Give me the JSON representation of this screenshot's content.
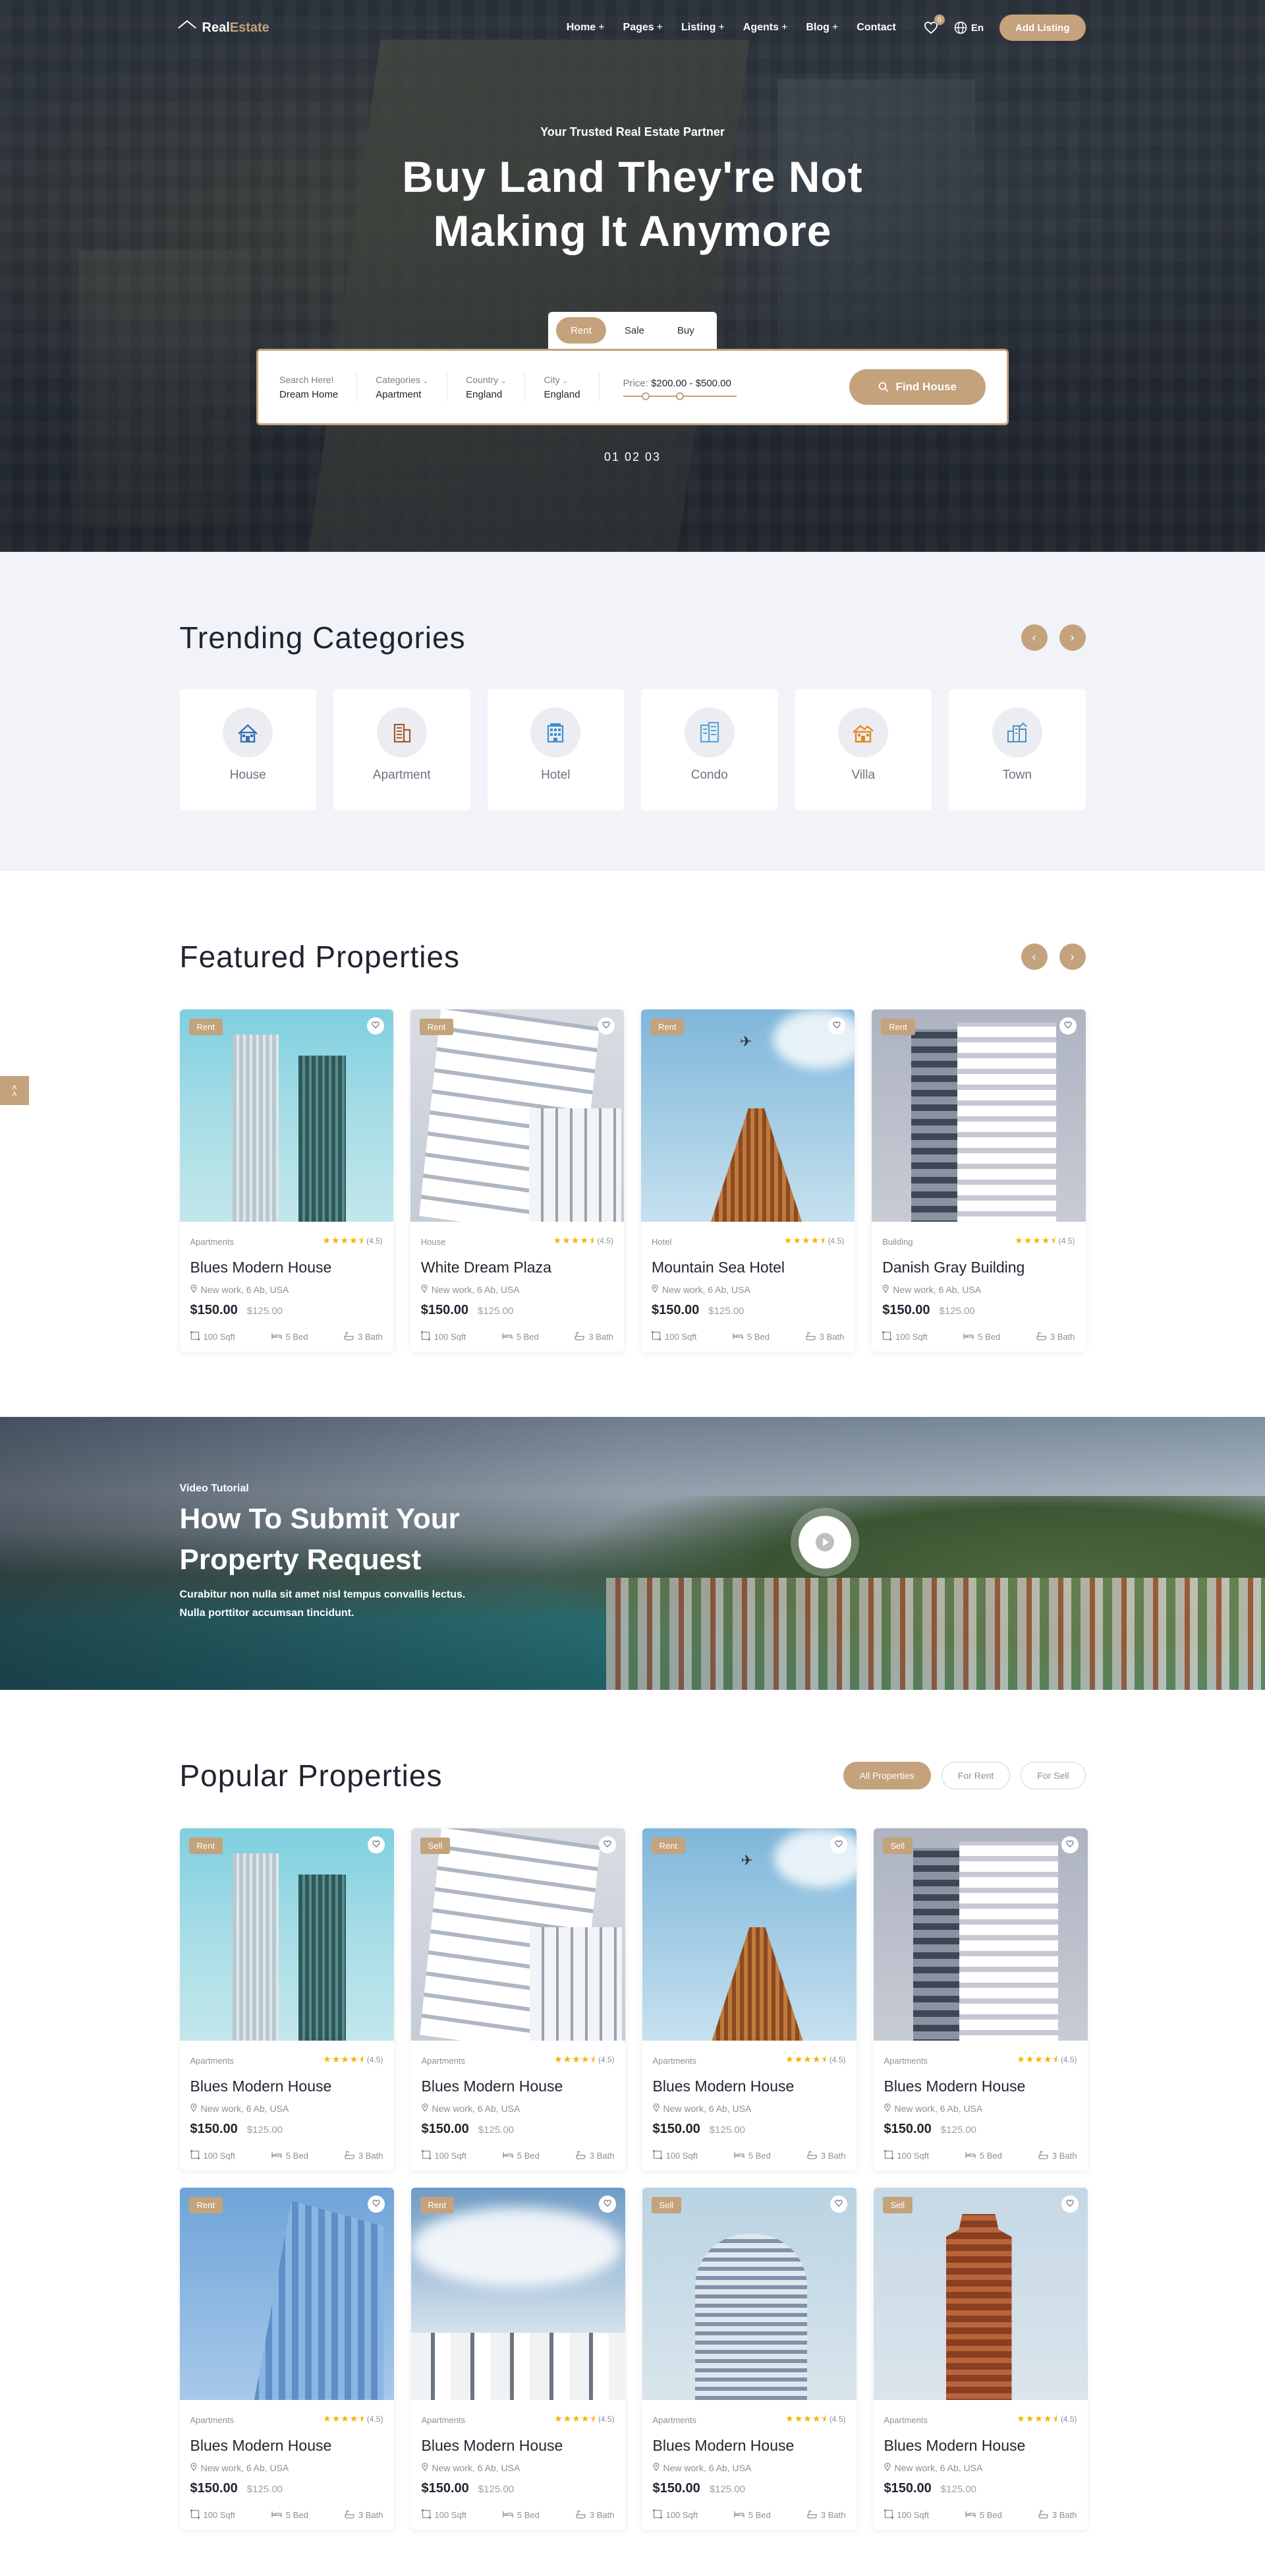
{
  "brand": {
    "name_a": "Real",
    "name_b": "Estate",
    "accent": "#c4a27c"
  },
  "nav": {
    "items": [
      {
        "label": "Home",
        "has_sub": true
      },
      {
        "label": "Pages",
        "has_sub": true
      },
      {
        "label": "Listing",
        "has_sub": true
      },
      {
        "label": "Agents",
        "has_sub": true
      },
      {
        "label": "Blog",
        "has_sub": true
      },
      {
        "label": "Contact",
        "has_sub": false
      }
    ],
    "wishlist_count": "0",
    "lang": "En",
    "cta": "Add Listing"
  },
  "hero": {
    "eyebrow": "Your Trusted Real Estate Partner",
    "title_line1": "Buy Land They're Not",
    "title_line2": "Making It Anymore",
    "tabs": [
      "Rent",
      "Sale",
      "Buy"
    ],
    "active_tab": "Rent",
    "search": {
      "keyword_label": "Search Here!",
      "keyword_value": "Dream Home",
      "category_label": "Categories",
      "category_value": "Apartment",
      "country_label": "Country",
      "country_value": "England",
      "city_label": "City",
      "city_value": "England",
      "price_label": "Price:",
      "price_value": "$200.00 - $500.00",
      "price_range": {
        "low_pct": 20,
        "high_pct": 50
      },
      "button": "Find House"
    },
    "slider_pager": "01 02 03"
  },
  "trending": {
    "title": "Trending Categories",
    "categories": [
      {
        "label": "House",
        "icon": "house-icon",
        "color": "#3a6fb5"
      },
      {
        "label": "Apartment",
        "icon": "apartment-icon",
        "color": "#a25a2e"
      },
      {
        "label": "Hotel",
        "icon": "hotel-icon",
        "color": "#3f8fc9"
      },
      {
        "label": "Condo",
        "icon": "condo-icon",
        "color": "#5aa6d9"
      },
      {
        "label": "Villa",
        "icon": "villa-icon",
        "color": "#e28a1e"
      },
      {
        "label": "Town",
        "icon": "town-icon",
        "color": "#4f8fc4"
      }
    ]
  },
  "featured": {
    "title": "Featured Properties",
    "cards": [
      {
        "tag": "Rent",
        "category": "Apartments",
        "title": "Blues Modern House",
        "location": "New work, 6 Ab, USA",
        "price": "$150.00",
        "old_price": "$125.00",
        "rating": 4.5,
        "rating_label": "(4.5)",
        "area": "100 Sqft",
        "beds": "5 Bed",
        "baths": "3 Bath",
        "img": "twin"
      },
      {
        "tag": "Rent",
        "category": "House",
        "title": "White Dream Plaza",
        "location": "New work, 6 Ab, USA",
        "price": "$150.00",
        "old_price": "$125.00",
        "rating": 4.5,
        "rating_label": "(4.5)",
        "area": "100 Sqft",
        "beds": "5 Bed",
        "baths": "3 Bath",
        "img": "white"
      },
      {
        "tag": "Rent",
        "category": "Hotel",
        "title": "Mountain Sea Hotel",
        "location": "New work, 6 Ab, USA",
        "price": "$150.00",
        "old_price": "$125.00",
        "rating": 4.5,
        "rating_label": "(4.5)",
        "area": "100 Sqft",
        "beds": "5 Bed",
        "baths": "3 Bath",
        "img": "tower"
      },
      {
        "tag": "Rent",
        "category": "Building",
        "title": "Danish Gray Building",
        "location": "New work, 6 Ab, USA",
        "price": "$150.00",
        "old_price": "$125.00",
        "rating": 4.5,
        "rating_label": "(4.5)",
        "area": "100 Sqft",
        "beds": "5 Bed",
        "baths": "3 Bath",
        "img": "gray"
      }
    ]
  },
  "video": {
    "eyebrow": "Video Tutorial",
    "title_line1": "How To Submit Your",
    "title_line2": "Property Request",
    "text": "Curabitur non nulla sit amet nisl tempus convallis lectus. Nulla porttitor accumsan tincidunt."
  },
  "popular": {
    "title": "Popular Properties",
    "filters": [
      "All Properties",
      "For Rent",
      "For Sell"
    ],
    "active_filter": "All Properties",
    "cards": [
      {
        "tag": "Rent",
        "category": "Apartments",
        "title": "Blues Modern House",
        "location": "New work, 6 Ab, USA",
        "price": "$150.00",
        "old_price": "$125.00",
        "rating": 4.5,
        "rating_label": "(4.5)",
        "area": "100 Sqft",
        "beds": "5 Bed",
        "baths": "3 Bath",
        "img": "twin"
      },
      {
        "tag": "Sell",
        "category": "Apartments",
        "title": "Blues Modern House",
        "location": "New work, 6 Ab, USA",
        "price": "$150.00",
        "old_price": "$125.00",
        "rating": 4.5,
        "rating_label": "(4.5)",
        "area": "100 Sqft",
        "beds": "5 Bed",
        "baths": "3 Bath",
        "img": "white"
      },
      {
        "tag": "Rent",
        "category": "Apartments",
        "title": "Blues Modern House",
        "location": "New work, 6 Ab, USA",
        "price": "$150.00",
        "old_price": "$125.00",
        "rating": 4.5,
        "rating_label": "(4.5)",
        "area": "100 Sqft",
        "beds": "5 Bed",
        "baths": "3 Bath",
        "img": "tower"
      },
      {
        "tag": "Sell",
        "category": "Apartments",
        "title": "Blues Modern House",
        "location": "New work, 6 Ab, USA",
        "price": "$150.00",
        "old_price": "$125.00",
        "rating": 4.5,
        "rating_label": "(4.5)",
        "area": "100 Sqft",
        "beds": "5 Bed",
        "baths": "3 Bath",
        "img": "gray"
      },
      {
        "tag": "Rent",
        "category": "Apartments",
        "title": "Blues Modern House",
        "location": "New work, 6 Ab, USA",
        "price": "$150.00",
        "old_price": "$125.00",
        "rating": 4.5,
        "rating_label": "(4.5)",
        "area": "100 Sqft",
        "beds": "5 Bed",
        "baths": "3 Bath",
        "img": "glass"
      },
      {
        "tag": "Rent",
        "category": "Apartments",
        "title": "Blues Modern House",
        "location": "New work, 6 Ab, USA",
        "price": "$150.00",
        "old_price": "$125.00",
        "rating": 4.5,
        "rating_label": "(4.5)",
        "area": "100 Sqft",
        "beds": "5 Bed",
        "baths": "3 Bath",
        "img": "cloud"
      },
      {
        "tag": "Sell",
        "category": "Apartments",
        "title": "Blues Modern House",
        "location": "New work, 6 Ab, USA",
        "price": "$150.00",
        "old_price": "$125.00",
        "rating": 4.5,
        "rating_label": "(4.5)",
        "area": "100 Sqft",
        "beds": "5 Bed",
        "baths": "3 Bath",
        "img": "round"
      },
      {
        "tag": "Sell",
        "category": "Apartments",
        "title": "Blues Modern House",
        "location": "New work, 6 Ab, USA",
        "price": "$150.00",
        "old_price": "$125.00",
        "rating": 4.5,
        "rating_label": "(4.5)",
        "area": "100 Sqft",
        "beds": "5 Bed",
        "baths": "3 Bath",
        "img": "brick"
      }
    ]
  }
}
